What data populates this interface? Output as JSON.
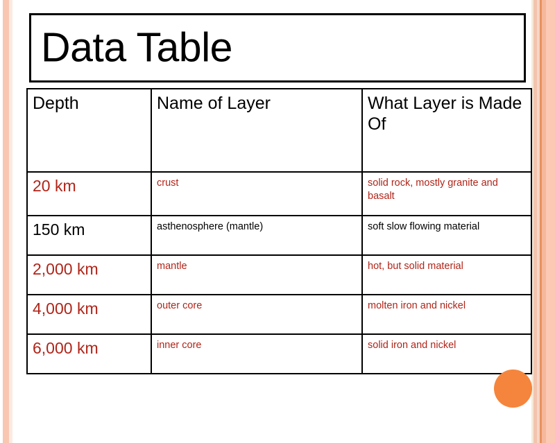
{
  "slide": {
    "title": "Data Table",
    "accent_salmon": "#f9c6b2",
    "accent_orange": "#f5853c",
    "text_red": "#b02418",
    "text_black": "#000000"
  },
  "table": {
    "columns": [
      {
        "label": "Depth"
      },
      {
        "label": "Name of Layer"
      },
      {
        "label": "What Layer is Made Of"
      }
    ],
    "rows": [
      {
        "depth": "20 km",
        "name": "crust",
        "made_of": "solid rock, mostly granite and basalt",
        "color": "red"
      },
      {
        "depth": "150 km",
        "name": "asthenosphere (mantle)",
        "made_of": "soft slow flowing material",
        "color": "black"
      },
      {
        "depth": "2,000 km",
        "name": "mantle",
        "made_of": "hot, but solid material",
        "color": "red"
      },
      {
        "depth": "4,000 km",
        "name": "outer core",
        "made_of": "molten iron and nickel",
        "color": "red"
      },
      {
        "depth": "6,000 km",
        "name": "inner core",
        "made_of": "solid iron and nickel",
        "color": "red"
      }
    ]
  }
}
